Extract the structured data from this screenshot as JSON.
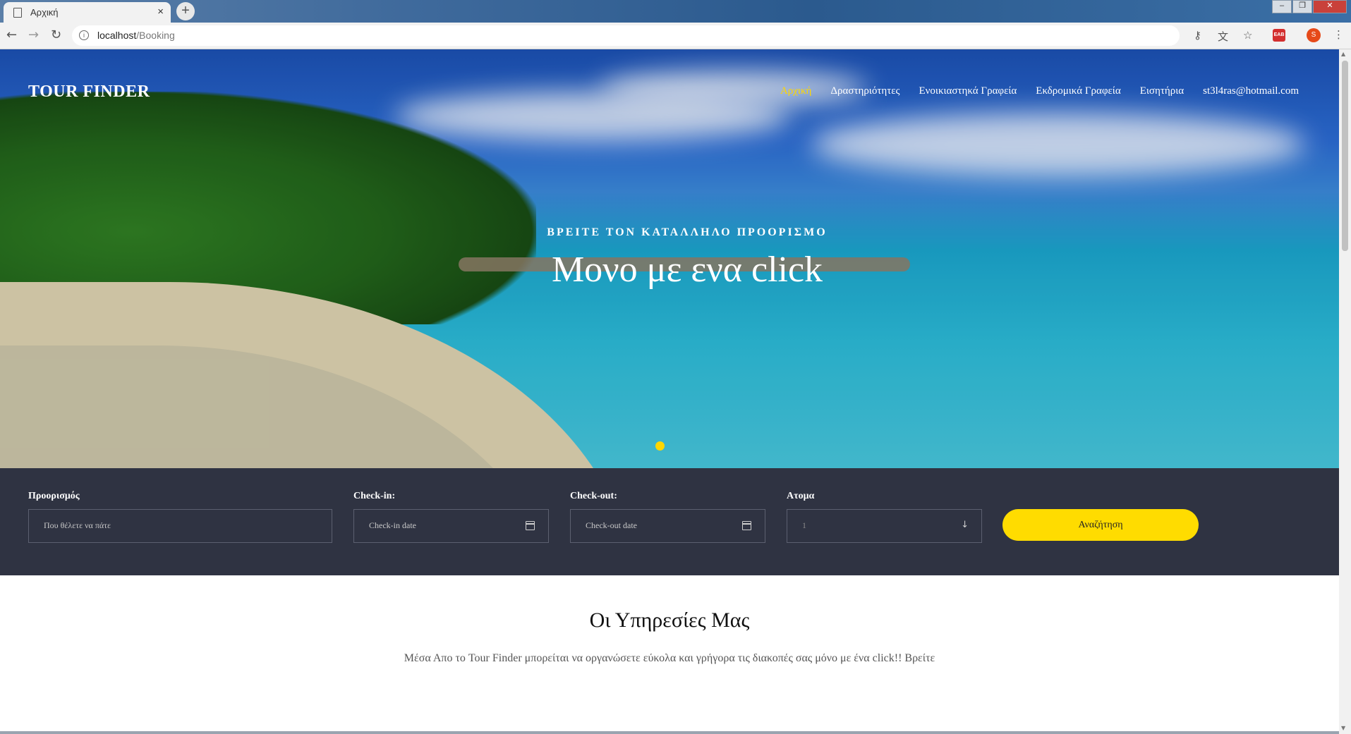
{
  "browser": {
    "tab_title": "Αρχική",
    "close_glyph": "×",
    "newtab_glyph": "+",
    "url_host": "localhost",
    "url_path": "/Booking",
    "ext_label": "EAB",
    "profile_initial": "S"
  },
  "site": {
    "brand": "TOUR FINDER",
    "nav": [
      {
        "label": "Αρχική",
        "active": true
      },
      {
        "label": "Δραστηριότητες"
      },
      {
        "label": "Ενοικιαστηκά Γραφεία"
      },
      {
        "label": "Εκδρομικά Γραφεία"
      },
      {
        "label": "Εισητήρια"
      },
      {
        "label": "st3l4ras@hotmail.com"
      }
    ]
  },
  "hero": {
    "subtitle": "ΒΡΕΙΤΕ ΤΟΝ ΚΑΤΑΛΛΗΛΟ ΠΡΟΟΡΙΣΜΟ",
    "title": "Μονο με ενα click"
  },
  "search": {
    "destination_label": "Προορισμός",
    "destination_placeholder": "Που θέλετε να πάτε",
    "checkin_label": "Check-in:",
    "checkin_placeholder": "Check-in date",
    "checkout_label": "Check-out:",
    "checkout_placeholder": "Check-out date",
    "people_label": "Ατομα",
    "people_value": "1",
    "button_label": "Αναζήτηση"
  },
  "services": {
    "title": "Οι Υπηρεσίες Μας",
    "text": "Μέσα Απο το Tour Finder μπορείται να οργανώσετε εύκολα και γρήγορα τις διακοπές σας μόνο με ένα click!! Βρείτε"
  },
  "colors": {
    "accent": "#ffdc00",
    "search_bg": "#2f3342"
  }
}
